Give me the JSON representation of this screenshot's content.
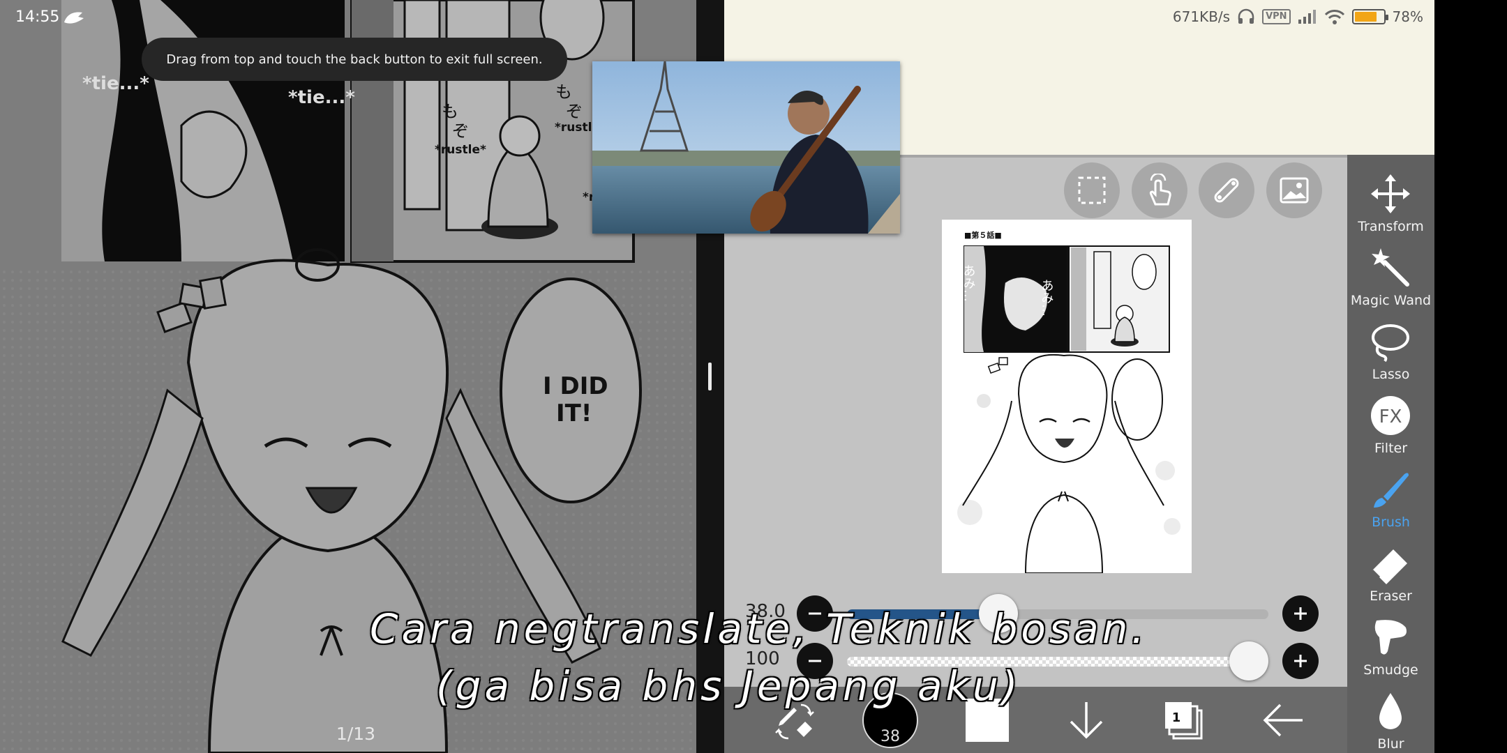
{
  "status_bar": {
    "time": "14:55",
    "network_speed": "671KB/s",
    "vpn_label": "VPN",
    "battery_percent": "78%",
    "battery_level": 0.78,
    "icons": [
      "app-notification-icon",
      "headphones-icon",
      "signal-icon",
      "wifi-icon",
      "battery-icon"
    ]
  },
  "toast": {
    "message": "Drag from top and touch the back button to exit full screen."
  },
  "manga_reader": {
    "page_indicator": "1/13",
    "sfx_text": [
      "*tie...*",
      "*tie...*",
      "*rustle*",
      "*rustle*",
      "*ru"
    ],
    "speech_bubble": "I DID IT!",
    "jp_sfx": [
      "も",
      "ぞ",
      "も",
      "ぞ"
    ]
  },
  "subtitles": {
    "line1": "Cara negtranslate, Teknik bosan.",
    "line2": "(ga bisa bhs Jepang aku)"
  },
  "paint_app": {
    "canvas_tools": [
      "select-tool-icon",
      "gesture-tool-icon",
      "ruler-tool-icon",
      "image-tool-icon"
    ],
    "artwork": {
      "chapter_label": "■第５話■",
      "jp_text_1": "あみ…",
      "jp_text_2": "あみ…"
    },
    "brush_size_slider": {
      "value": "38.0",
      "fraction": 0.36
    },
    "opacity_slider": {
      "value": "100",
      "fraction": 1.0
    },
    "bottom_bar": {
      "brush_size": "38",
      "color": "#ffffff",
      "layer_count": "1",
      "items": [
        "pen-eraser-swap-icon",
        "brush-size-indicator",
        "color-swatch",
        "down-arrow-icon",
        "layers-icon",
        "undo-arrow-icon"
      ]
    },
    "tool_panel": [
      {
        "label": "Transform",
        "icon": "transform-icon",
        "active": false
      },
      {
        "label": "Magic Wand",
        "icon": "magic-wand-icon",
        "active": false
      },
      {
        "label": "Lasso",
        "icon": "lasso-icon",
        "active": false
      },
      {
        "label": "Filter",
        "icon": "fx-icon",
        "active": false,
        "icon_text": "FX"
      },
      {
        "label": "Brush",
        "icon": "brush-icon",
        "active": true
      },
      {
        "label": "Eraser",
        "icon": "eraser-icon",
        "active": false
      },
      {
        "label": "Smudge",
        "icon": "smudge-icon",
        "active": false
      },
      {
        "label": "Blur",
        "icon": "blur-drop-icon",
        "active": false
      }
    ],
    "colors": {
      "active_tool": "#4aa3f0",
      "slider_fill": "#245589",
      "battery": "#f2a516"
    }
  }
}
